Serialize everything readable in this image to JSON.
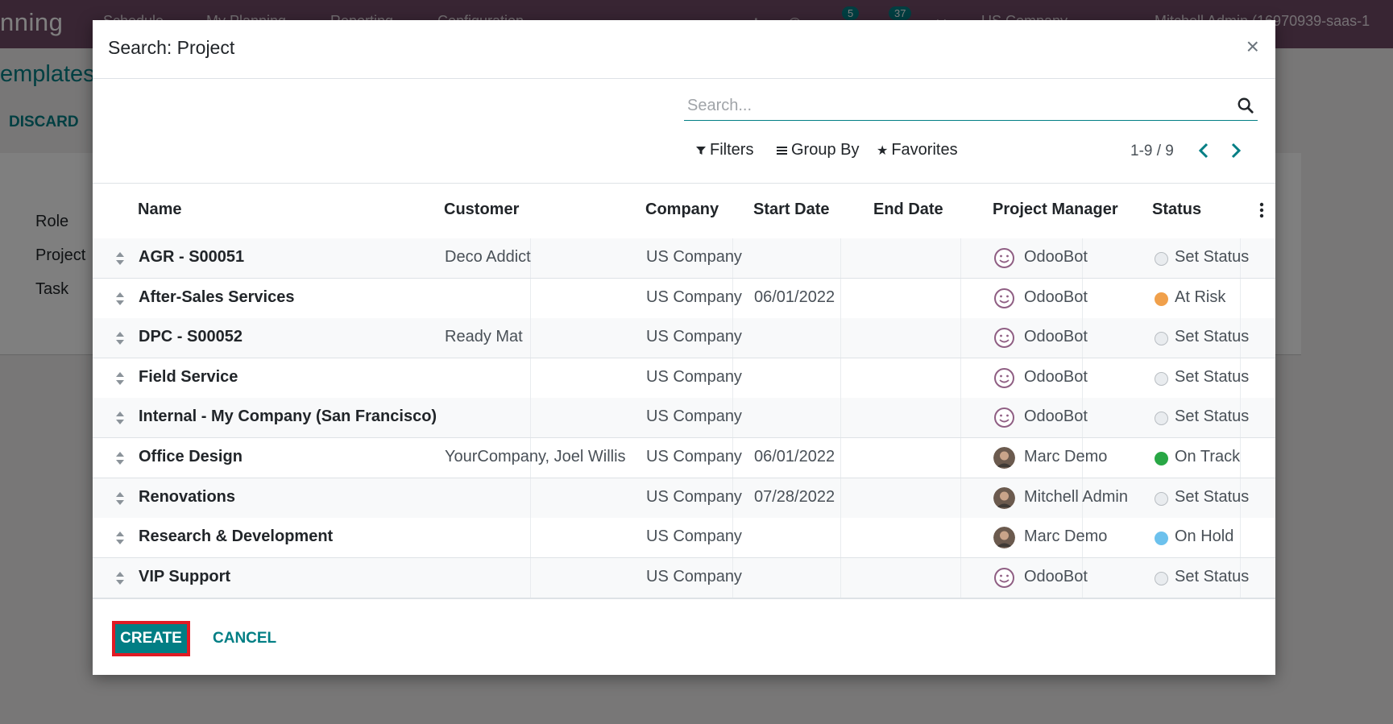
{
  "app": {
    "name": "nning",
    "menu": [
      "Schedule",
      "My Planning",
      "Reporting",
      "Configuration"
    ],
    "messages_count": "5",
    "activities_count": "37",
    "company": "US Company",
    "user": "Mitchell Admin (16970939-saas-1"
  },
  "background": {
    "breadcrumb": "emplates /",
    "discard_label": "DISCARD",
    "fields": [
      "Role",
      "Project",
      "Task"
    ]
  },
  "dialog": {
    "title": "Search: Project",
    "close_glyph": "×",
    "search_placeholder": "Search...",
    "filters_label": "Filters",
    "groupby_label": "Group By",
    "favorites_label": "Favorites",
    "pager": "1-9 / 9",
    "columns": {
      "name": "Name",
      "customer": "Customer",
      "company": "Company",
      "start_date": "Start Date",
      "end_date": "End Date",
      "manager": "Project Manager",
      "status": "Status"
    },
    "rows": [
      {
        "name": "AGR - S00051",
        "customer": "Deco Addict",
        "company": "US Company",
        "start_date": "",
        "end_date": "",
        "manager": "OdooBot",
        "manager_avatar": "odoobot",
        "status": "Set Status",
        "status_color": "#e9ecef"
      },
      {
        "name": "After-Sales Services",
        "customer": "",
        "company": "US Company",
        "start_date": "06/01/2022",
        "end_date": "",
        "manager": "OdooBot",
        "manager_avatar": "odoobot",
        "status": "At Risk",
        "status_color": "#f0a04b"
      },
      {
        "name": "DPC - S00052",
        "customer": "Ready Mat",
        "company": "US Company",
        "start_date": "",
        "end_date": "",
        "manager": "OdooBot",
        "manager_avatar": "odoobot",
        "status": "Set Status",
        "status_color": "#e9ecef"
      },
      {
        "name": "Field Service",
        "customer": "",
        "company": "US Company",
        "start_date": "",
        "end_date": "",
        "manager": "OdooBot",
        "manager_avatar": "odoobot",
        "status": "Set Status",
        "status_color": "#e9ecef"
      },
      {
        "name": "Internal - My Company (San Francisco)",
        "customer": "",
        "company": "US Company",
        "start_date": "",
        "end_date": "",
        "manager": "OdooBot",
        "manager_avatar": "odoobot",
        "status": "Set Status",
        "status_color": "#e9ecef"
      },
      {
        "name": "Office Design",
        "customer": "YourCompany, Joel Willis",
        "company": "US Company",
        "start_date": "06/01/2022",
        "end_date": "",
        "manager": "Marc Demo",
        "manager_avatar": "person",
        "status": "On Track",
        "status_color": "#28a745"
      },
      {
        "name": "Renovations",
        "customer": "",
        "company": "US Company",
        "start_date": "07/28/2022",
        "end_date": "",
        "manager": "Mitchell Admin",
        "manager_avatar": "person",
        "status": "Set Status",
        "status_color": "#e9ecef"
      },
      {
        "name": "Research & Development",
        "customer": "",
        "company": "US Company",
        "start_date": "",
        "end_date": "",
        "manager": "Marc Demo",
        "manager_avatar": "person",
        "status": "On Hold",
        "status_color": "#6cc1ed"
      },
      {
        "name": "VIP Support",
        "customer": "",
        "company": "US Company",
        "start_date": "",
        "end_date": "",
        "manager": "OdooBot",
        "manager_avatar": "odoobot",
        "status": "Set Status",
        "status_color": "#e9ecef"
      }
    ],
    "create_label": "CREATE",
    "cancel_label": "CANCEL"
  },
  "colors": {
    "brand": "#714b67",
    "accent": "#017e84",
    "highlight_border": "#e01b24"
  }
}
